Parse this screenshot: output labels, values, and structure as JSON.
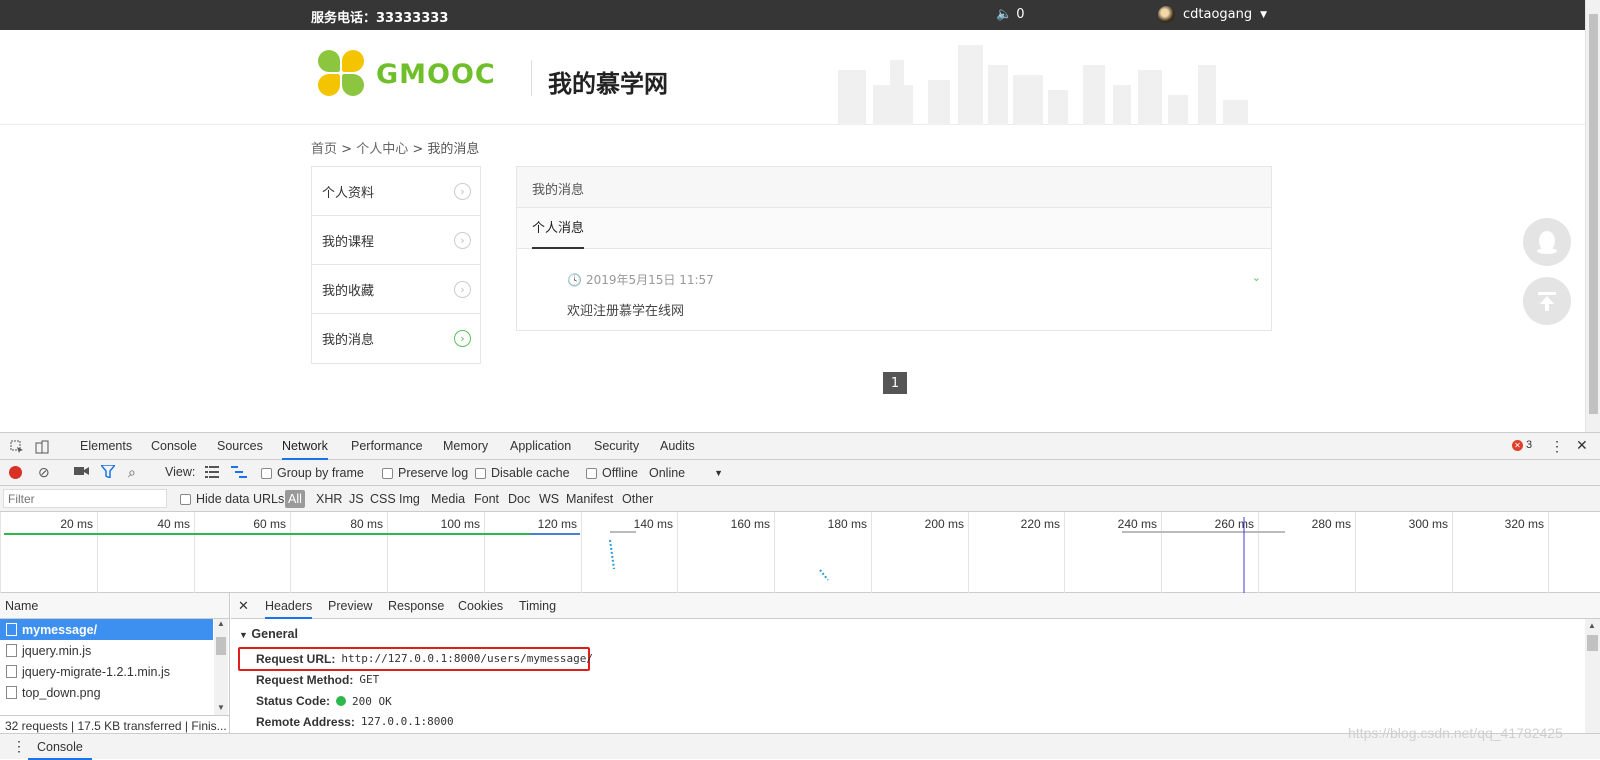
{
  "topbar": {
    "phone": "服务电话：33333333",
    "notif_count": "0",
    "username": "cdtaogang"
  },
  "header": {
    "logo_text": "GMOOC",
    "title": "我的慕学网"
  },
  "breadcrumb": {
    "home": "首页",
    "sep1": " > ",
    "center": "个人中心",
    "sep2": " > ",
    "current": "我的消息"
  },
  "sidebar": {
    "items": [
      {
        "label": "个人资料"
      },
      {
        "label": "我的课程"
      },
      {
        "label": "我的收藏"
      },
      {
        "label": "我的消息"
      }
    ]
  },
  "panel": {
    "title": "我的消息",
    "tab": "个人消息",
    "message": {
      "date": "2019年5月15日 11:57",
      "text": "欢迎注册慕学在线网"
    }
  },
  "pagination": {
    "current": "1"
  },
  "devtools": {
    "tabs": [
      "Elements",
      "Console",
      "Sources",
      "Network",
      "Performance",
      "Memory",
      "Application",
      "Security",
      "Audits"
    ],
    "error_count": "3",
    "toolbar": {
      "view_label": "View:",
      "group_by_frame": "Group by frame",
      "preserve_log": "Preserve log",
      "disable_cache": "Disable cache",
      "offline": "Offline",
      "throttle": "Online"
    },
    "filter": {
      "placeholder": "Filter",
      "hide_data_urls": "Hide data URLs",
      "types": [
        "All",
        "XHR",
        "JS",
        "CSS",
        "Img",
        "Media",
        "Font",
        "Doc",
        "WS",
        "Manifest",
        "Other"
      ]
    },
    "timeline_ticks": [
      "20 ms",
      "40 ms",
      "60 ms",
      "80 ms",
      "100 ms",
      "120 ms",
      "140 ms",
      "160 ms",
      "180 ms",
      "200 ms",
      "220 ms",
      "240 ms",
      "260 ms",
      "280 ms",
      "300 ms",
      "320 ms"
    ],
    "name_header": "Name",
    "requests": [
      "mymessage/",
      "jquery.min.js",
      "jquery-migrate-1.2.1.min.js",
      "top_down.png"
    ],
    "summary": "32 requests | 17.5 KB transferred | Finis...",
    "detail_tabs": [
      "Headers",
      "Preview",
      "Response",
      "Cookies",
      "Timing"
    ],
    "general": {
      "section": "General",
      "request_url_label": "Request URL:",
      "request_url": "http://127.0.0.1:8000/users/mymessage/",
      "method_label": "Request Method:",
      "method": "GET",
      "status_label": "Status Code:",
      "status": "200 OK",
      "remote_label": "Remote Address:",
      "remote": "127.0.0.1:8000"
    },
    "drawer_tab": "Console"
  },
  "watermark": "https://blog.csdn.net/qq_41782425"
}
